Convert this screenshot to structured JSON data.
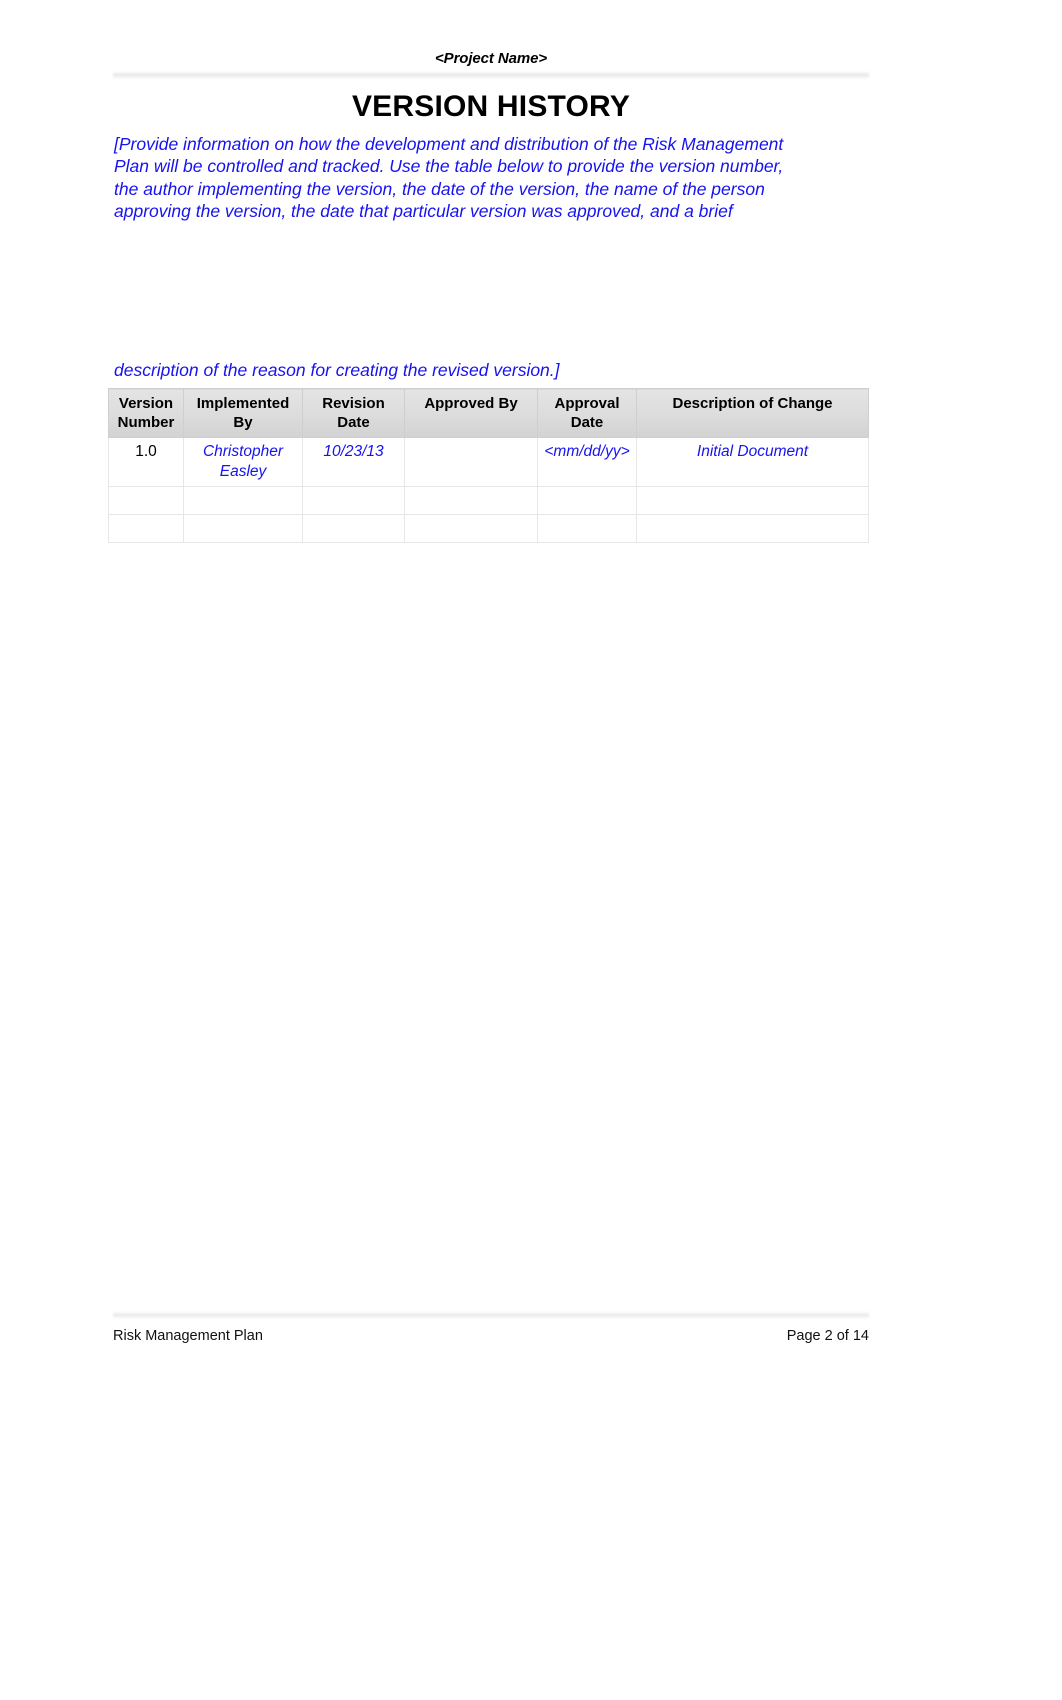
{
  "header": {
    "project_name": "<Project Name>"
  },
  "title": "VERSION HISTORY",
  "instructions": {
    "line1": "[Provide information on how the development and distribution of the Risk Management",
    "line2": "Plan will be controlled and tracked. Use the table below to provide the version number,",
    "line3": "the author implementing the version, the date of the version, the name of the person",
    "line4": "approving  the  version,  the  date  that  particular  version  was  approved,  and  a  brief",
    "line5": "description of the reason for creating the revised version.]"
  },
  "table": {
    "headers": [
      "Version Number",
      "Implemented By",
      "Revision Date",
      "Approved By",
      "Approval Date",
      "Description of Change"
    ],
    "rows": [
      {
        "version_number": "1.0",
        "implemented_by": "Christopher Easley",
        "revision_date": "10/23/13",
        "approved_by": "",
        "approval_date": "<mm/dd/yy>",
        "description_of_change": "Initial Document"
      },
      {
        "version_number": "",
        "implemented_by": "",
        "revision_date": "",
        "approved_by": "",
        "approval_date": "",
        "description_of_change": ""
      },
      {
        "version_number": "",
        "implemented_by": "",
        "revision_date": "",
        "approved_by": "",
        "approval_date": "",
        "description_of_change": ""
      }
    ]
  },
  "footer": {
    "document_name": "Risk Management Plan",
    "page_label": "Page 2 of 14"
  },
  "colors": {
    "instruction_blue": "#1712f0",
    "body_text": "#000000",
    "table_header_bg": "#dcdcdc"
  }
}
